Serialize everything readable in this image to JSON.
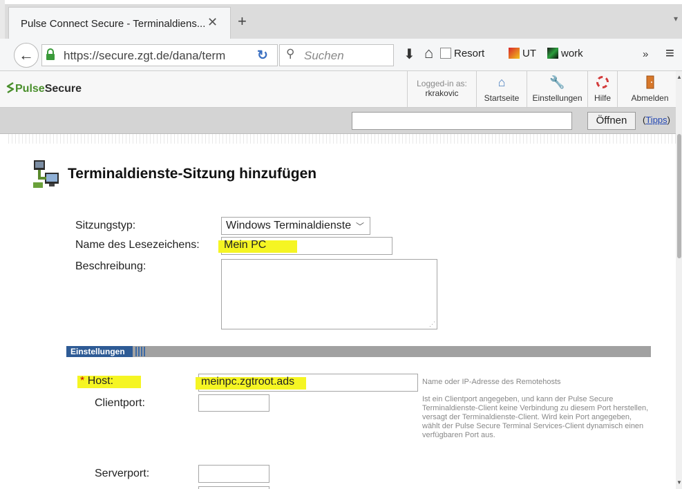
{
  "browser": {
    "tab_title": "Pulse Connect Secure - Terminaldiens...",
    "tab_close": "✕",
    "new_tab": "+",
    "url": "https://secure.zgt.de/dana/term",
    "search_placeholder": "Suchen",
    "bookmarks": [
      {
        "label": "Resort",
        "icon": "folder-icon",
        "color": "#ffffff"
      },
      {
        "label": "UT",
        "icon": "ut-icon",
        "color": "#e7b21f"
      },
      {
        "label": "work",
        "icon": "work-icon",
        "color": "#2b9e3c"
      }
    ],
    "overflow": "»"
  },
  "pulse_header": {
    "logo_pulse": "Pulse",
    "logo_secure": "Secure",
    "logged_in_label": "Logged-in as:",
    "username": "rkrakovic",
    "buttons": {
      "startseite": "Startseite",
      "einstellungen": "Einstellungen",
      "hilfe": "Hilfe",
      "abmelden": "Abmelden"
    }
  },
  "subbar": {
    "open_label": "Öffnen",
    "tips_open": "(",
    "tips_link": "Tipps",
    "tips_close": ")"
  },
  "form": {
    "title": "Terminaldienste-Sitzung hinzufügen",
    "sitzungstyp_label": "Sitzungstyp:",
    "sitzungstyp_value": "Windows Terminaldienste",
    "name_label": "Name des Lesezeichens:",
    "name_value": "Mein PC",
    "beschreibung_label": "Beschreibung:",
    "section_title": "Einstellungen",
    "host_required_mark": "*",
    "host_label": "Host:",
    "host_value": "meinpc.zgtroot.ads",
    "host_help": "Name oder IP-Adresse des Remotehosts",
    "clientport_label": "Clientport:",
    "clientport_help": "Ist ein Clientport angegeben, und kann der Pulse Secure Terminaldienste-Client keine Verbindung zu diesem Port herstellen, versagt der Terminaldienste-Client. Wird kein Port angegeben, wählt der Pulse Secure Terminal Services-Client dynamisch einen verfügbaren Port aus.",
    "serverport_label": "Serverport:"
  },
  "colors": {
    "highlight": "#f5f523",
    "section_tab": "#2e5b95",
    "pulse_green": "#4a8f2c"
  }
}
